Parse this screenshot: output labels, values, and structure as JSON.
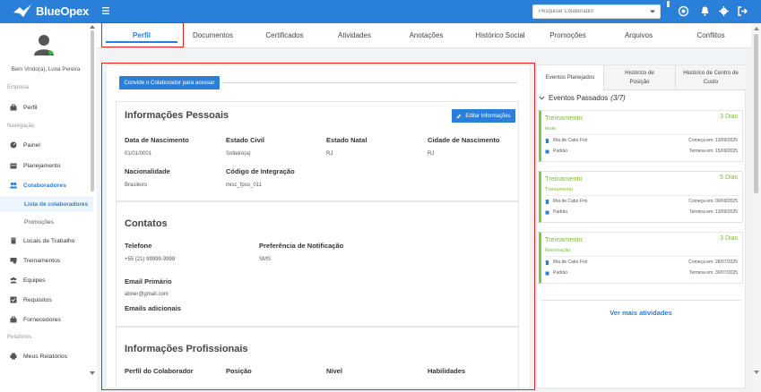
{
  "app": {
    "name": "BlueOpex"
  },
  "colors": {
    "primary": "#2a7fd9",
    "success": "#7ab83a",
    "highlight": "#e02424"
  },
  "header": {
    "search_placeholder": "Pesquisar Colaborador"
  },
  "sidebar": {
    "welcome": "Bem Vindo(a), Luna Pereira",
    "sections": {
      "empresa": "Empresa",
      "navegacao": "Navegação",
      "relatorios": "Relatórios"
    },
    "items": {
      "perfil": "Perfil",
      "painel": "Painel",
      "planejamento": "Planejamento",
      "colaboradores": "Colaboradores",
      "lista": "Lista de colaboradores",
      "promocoes": "Promoções",
      "locais": "Locais de Trabalho",
      "treinamentos": "Treinamentos",
      "equipes": "Equipes",
      "requisitos": "Requisitos",
      "fornecedores": "Fornecedores",
      "relatorios": "Meus Relatórios"
    }
  },
  "tabs": [
    "Perfil",
    "Documentos",
    "Certificados",
    "Atividades",
    "Anotações",
    "Histórico Social",
    "Promoções",
    "Arquivos",
    "Conflitos"
  ],
  "invite_button": "Convide o Colaborador para acessar",
  "personal": {
    "title": "Informações Pessoais",
    "edit_button": "Editar Informações",
    "fields": [
      {
        "label": "Data de Nascimento",
        "value": "01/01/0001"
      },
      {
        "label": "Estado Civil",
        "value": "Solteiro(a)"
      },
      {
        "label": "Estado Natal",
        "value": "RJ"
      },
      {
        "label": "Cidade de Nascimento",
        "value": "RJ"
      },
      {
        "label": "Nacionalidade",
        "value": "Brasileiro"
      },
      {
        "label": "Código de Integração",
        "value": "misc_fpso_011"
      }
    ]
  },
  "contacts": {
    "title": "Contatos",
    "phone_label": "Telefone",
    "phone_value": "+55 (21) 99999-9999",
    "notify_label": "Preferência de Notificação",
    "notify_value": "SMS",
    "email_label": "Email Primário",
    "email_value": "abner@gmail.com",
    "extra_emails_label": "Emails adicionais"
  },
  "professional": {
    "title": "Informações Profissionais",
    "labels": [
      "Perfil do Colaborador",
      "Posição",
      "Nível",
      "Habilidades"
    ]
  },
  "right_panel": {
    "tabs": [
      "Eventos Planejados",
      "Histórico de Posição",
      "Histórico de Centro de Custo"
    ],
    "past_title": "Eventos Passados",
    "past_count": "(3/7)",
    "events": [
      {
        "title": "Treinamento",
        "days": "3 Dias",
        "subtitle": "teste",
        "location": "Ilha de Cabo Frio",
        "start": "Começa em: 13/09/2025",
        "type": "Padrão",
        "end": "Termina em: 15/09/2025"
      },
      {
        "title": "Treinamento",
        "days": "5 Dias",
        "subtitle": "Treinamento",
        "location": "Ilha de Cabo Frio",
        "start": "Começa em: 09/09/2025",
        "type": "Padrão",
        "end": "Termina em: 13/09/2025"
      },
      {
        "title": "Treinamento",
        "days": "3 Dias",
        "subtitle": "Renovação",
        "location": "Ilha de Cabo Frio",
        "start": "Começa em: 28/07/2025",
        "type": "Padrão",
        "end": "Termina em: 30/07/2025"
      }
    ],
    "more_link": "Ver mais atividades"
  }
}
